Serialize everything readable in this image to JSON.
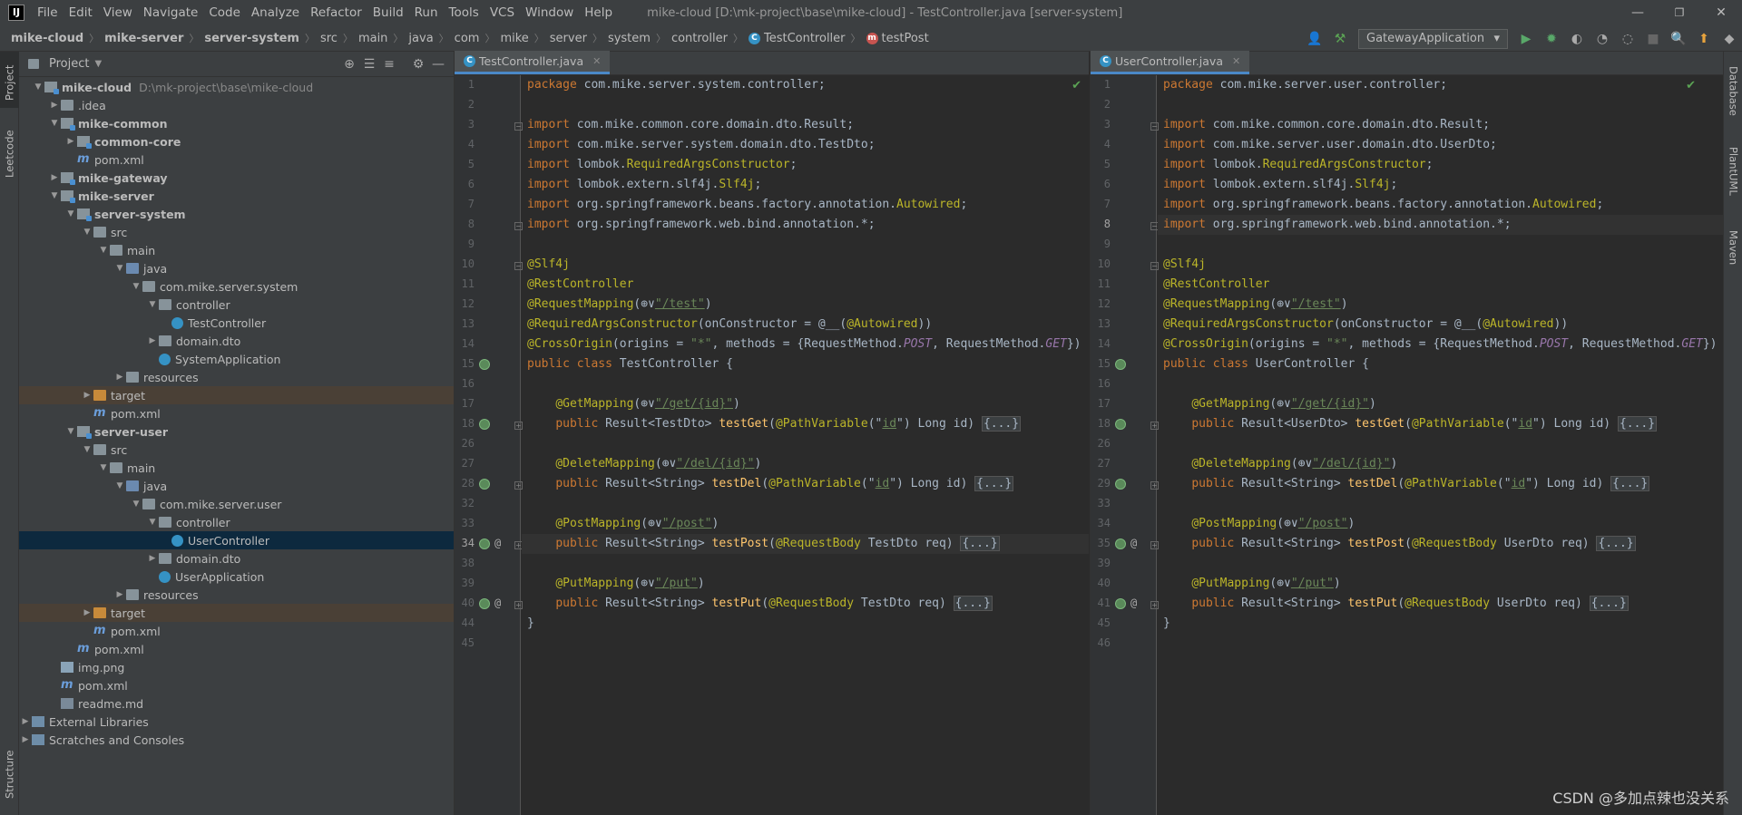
{
  "menubar": {
    "logo": "IJ",
    "items": [
      "File",
      "Edit",
      "View",
      "Navigate",
      "Code",
      "Analyze",
      "Refactor",
      "Build",
      "Run",
      "Tools",
      "VCS",
      "Window",
      "Help"
    ],
    "title": "mike-cloud [D:\\mk-project\\base\\mike-cloud] - TestController.java [server-system]",
    "minimize": "—",
    "maximize": "❐",
    "close": "✕"
  },
  "breadcrumbs": {
    "items": [
      "mike-cloud",
      "mike-server",
      "server-system",
      "src",
      "main",
      "java",
      "com",
      "mike",
      "server",
      "system",
      "controller",
      "TestController",
      "testPost"
    ]
  },
  "toolbar": {
    "run_config": "GatewayApplication"
  },
  "left_strip": {
    "project": "Project",
    "leetcode": "Leetcode",
    "structure": "Structure"
  },
  "right_strip": {
    "database": "Database",
    "plantuml": "PlantUML",
    "maven": "Maven"
  },
  "project": {
    "title": "Project",
    "tree": [
      {
        "label": "mike-cloud",
        "path": "D:\\mk-project\\base\\mike-cloud"
      },
      {
        "label": ".idea"
      },
      {
        "label": "mike-common"
      },
      {
        "label": "common-core"
      },
      {
        "label": "pom.xml"
      },
      {
        "label": "mike-gateway"
      },
      {
        "label": "mike-server"
      },
      {
        "label": "server-system"
      },
      {
        "label": "src"
      },
      {
        "label": "main"
      },
      {
        "label": "java"
      },
      {
        "label": "com.mike.server.system"
      },
      {
        "label": "controller"
      },
      {
        "label": "TestController"
      },
      {
        "label": "domain.dto"
      },
      {
        "label": "SystemApplication"
      },
      {
        "label": "resources"
      },
      {
        "label": "target"
      },
      {
        "label": "pom.xml"
      },
      {
        "label": "server-user"
      },
      {
        "label": "src"
      },
      {
        "label": "main"
      },
      {
        "label": "java"
      },
      {
        "label": "com.mike.server.user"
      },
      {
        "label": "controller"
      },
      {
        "label": "UserController"
      },
      {
        "label": "domain.dto"
      },
      {
        "label": "UserApplication"
      },
      {
        "label": "resources"
      },
      {
        "label": "target"
      },
      {
        "label": "pom.xml"
      },
      {
        "label": "pom.xml"
      },
      {
        "label": "img.png"
      },
      {
        "label": "pom.xml"
      },
      {
        "label": "readme.md"
      },
      {
        "label": "External Libraries"
      },
      {
        "label": "Scratches and Consoles"
      }
    ]
  },
  "left_editor": {
    "tab": "TestController.java",
    "line_numbers": [
      "1",
      "2",
      "3",
      "4",
      "5",
      "6",
      "7",
      "8",
      "9",
      "10",
      "11",
      "12",
      "13",
      "14",
      "15",
      "16",
      "17",
      "18",
      "26",
      "27",
      "28",
      "32",
      "33",
      "34",
      "38",
      "39",
      "40",
      "44",
      "45"
    ],
    "code": {
      "package_kw": "package",
      "package_name": " com.mike.server.system.controller;",
      "imp": "import",
      "i1": " com.mike.common.core.domain.dto.Result;",
      "i2": " com.mike.server.system.domain.dto.TestDto;",
      "i3a": " lombok.",
      "i3b": "RequiredArgsConstructor",
      "i3c": ";",
      "i4a": " lombok.extern.slf4j.",
      "i4b": "Slf4j",
      "i4c": ";",
      "i5a": " org.springframework.beans.factory.annotation.",
      "i5b": "Autowired",
      "i5c": ";",
      "i6": " org.springframework.web.bind.annotation.*;",
      "a1": "@Slf4j",
      "a2": "@RestController",
      "a3": "@RequestMapping",
      "a3b": "(",
      "a3c": "⊕∨",
      "a3d": "\"/test\"",
      "a3e": ")",
      "a4": "@RequiredArgsConstructor",
      "a4b": "(onConstructor = @__(",
      "a4c": "@Autowired",
      "a4d": "))",
      "a5": "@CrossOrigin",
      "a5b": "(origins = ",
      "a5c": "\"*\"",
      "a5d": ", methods = {RequestMethod.",
      "a5e": "POST",
      "a5f": ", RequestMethod.",
      "a5g": "GET",
      "a5h": "})",
      "cls_kw": "public class",
      "cls_name": " TestController {",
      "m1a": "@GetMapping",
      "m1p": "\"/get/{id}\"",
      "m1b": "Result<TestDto> ",
      "m1f": "testGet",
      "m1c": "(",
      "m1d": "@PathVariable",
      "m1e": "(\"",
      "m1id": "id",
      "m1g": "\") Long id) ",
      "fold": "{...}",
      "m2a": "@DeleteMapping",
      "m2p": "\"/del/{id}\"",
      "m2b": "Result<String> ",
      "m2f": "testDel",
      "m3a": "@PostMapping",
      "m3p": "\"/post\"",
      "m3f": "testPost",
      "m3d": "@RequestBody",
      "m3e": " TestDto req) ",
      "m4a": "@PutMapping",
      "m4p": "\"/put\"",
      "m4f": "testPut",
      "pub": "public ",
      "close": "}",
      "op": "(",
      "cp": ")",
      "pi": "⊕∨"
    }
  },
  "right_editor": {
    "tab": "UserController.java",
    "line_numbers": [
      "1",
      "2",
      "3",
      "4",
      "5",
      "6",
      "7",
      "8",
      "9",
      "10",
      "11",
      "12",
      "13",
      "14",
      "15",
      "16",
      "17",
      "18",
      "26",
      "27",
      "29",
      "33",
      "34",
      "35",
      "39",
      "40",
      "41",
      "45",
      "46"
    ],
    "code": {
      "package_name": " com.mike.server.user.controller;",
      "i2": " com.mike.server.user.domain.dto.UserDto;",
      "i5a": " org.springframework.beans.factory.annotation.",
      "i6": " org.springframework.web.bind.annotation.*;",
      "cls_name": " UserController {",
      "m1b": "Result<UserDto> ",
      "m3e": " UserDto req) "
    }
  },
  "watermark": "CSDN @多加点辣也没关系"
}
